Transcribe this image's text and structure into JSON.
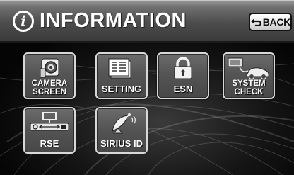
{
  "header": {
    "title": "INFORMATION",
    "back_label": "BACK",
    "info_icon": "information-icon",
    "back_icon": "return-arrow-icon"
  },
  "tiles": [
    {
      "label_lines": [
        "CAMERA",
        "SCREEN"
      ],
      "icon": "camera-icon"
    },
    {
      "label": "SETTING",
      "icon": "settings-list-icon"
    },
    {
      "label": "ESN",
      "icon": "padlock-icon"
    },
    {
      "label_lines": [
        "SYSTEM",
        "CHECK"
      ],
      "icon": "car-diagnostic-icon"
    },
    {
      "label": "RSE",
      "icon": "rear-seat-entertainment-icon"
    },
    {
      "label": "SIRIUS ID",
      "icon": "satellite-dish-icon"
    }
  ],
  "colors": {
    "header_top": "#9a9a9a",
    "header_bottom": "#3a3a3a",
    "tile_border": "#d8d8d8",
    "background": "#060606"
  }
}
